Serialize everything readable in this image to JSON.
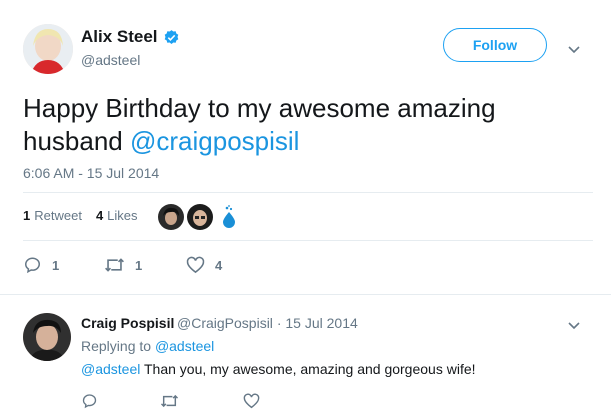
{
  "author": {
    "name": "Alix Steel",
    "handle": "@adsteel",
    "verified": true
  },
  "follow_button": {
    "label": "Follow"
  },
  "tweet": {
    "text_plain": "Happy Birthday to my awesome amazing husband ",
    "mention": "@craigpospisil",
    "timestamp": "6:06 AM - 15 Jul 2014"
  },
  "stats": {
    "retweets_count": "1",
    "retweets_label": "Retweet",
    "likes_count": "4",
    "likes_label": "Likes"
  },
  "actions": {
    "reply_count": "1",
    "retweet_count": "1",
    "like_count": "4"
  },
  "reply": {
    "name": "Craig Pospisil",
    "handle": "@CraigPospisil",
    "separator": "·",
    "date": "15 Jul 2014",
    "replying_prefix": "Replying to",
    "replying_to": "@adsteel",
    "mention": "@adsteel",
    "text": " Than you, my awesome, amazing and gorgeous wife!"
  },
  "colors": {
    "accent": "#1da1f2",
    "link": "#1b95e0",
    "muted": "#657786",
    "divider": "#e6ecf0"
  },
  "icons": [
    "verified-badge-icon",
    "chevron-down-icon",
    "reply-icon",
    "retweet-icon",
    "like-icon"
  ]
}
